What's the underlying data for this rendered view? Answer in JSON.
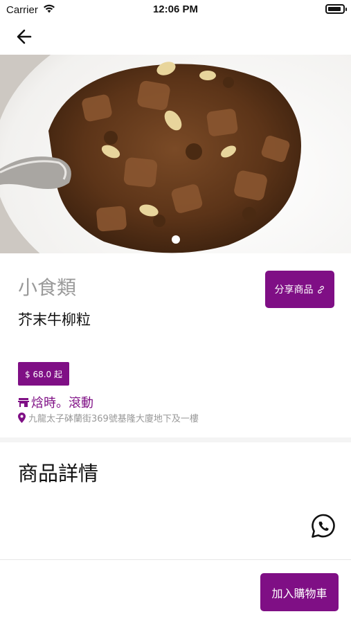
{
  "status_bar": {
    "carrier": "Carrier",
    "time": "12:06 PM",
    "battery_level": 0.9
  },
  "product": {
    "category": "小食類",
    "name": "芥末牛柳粒",
    "price": "$ 68.0 起",
    "image_count": 1,
    "current_image": 1
  },
  "share": {
    "label": "分享商品"
  },
  "shop": {
    "name": "焓時。滾動",
    "address": "九龍太子砵蘭街369號基隆大廈地下及一樓"
  },
  "details": {
    "title": "商品詳情"
  },
  "cart": {
    "add_label": "加入購物車"
  },
  "colors": {
    "accent": "#7f0f85",
    "category_gray": "#9a9a9a",
    "address_gray": "#999999"
  },
  "icons": [
    "wifi-icon",
    "battery-icon",
    "back-arrow-icon",
    "link-icon",
    "store-icon",
    "location-pin-icon",
    "whatsapp-icon"
  ]
}
